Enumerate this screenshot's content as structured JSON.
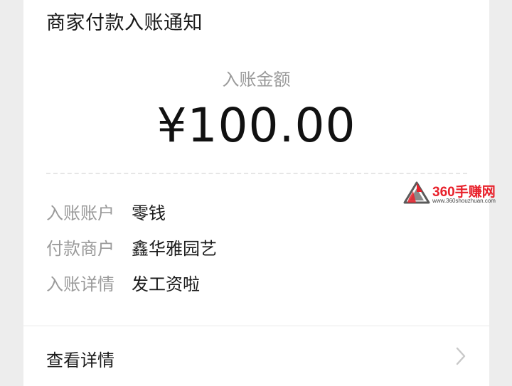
{
  "card": {
    "title": "商家付款入账通知",
    "amount_label": "入账金额",
    "amount": "¥100.00"
  },
  "details_rows": [
    {
      "key": "入账账户",
      "value": "零钱"
    },
    {
      "key": "付款商户",
      "value": "鑫华雅园艺"
    },
    {
      "key": "入账详情",
      "value": "发工资啦"
    }
  ],
  "footer": {
    "view_details_label": "查看详情",
    "chevron_icon": "chevron-right-icon"
  },
  "watermark": {
    "brand": "360手赚网",
    "url": "www.360shouzhuan.com"
  },
  "colors": {
    "background": "#ededed",
    "card": "#ffffff",
    "label_gray": "#9a9a9a",
    "text_dark": "#1a1a1a",
    "watermark_red": "#e8212b"
  }
}
